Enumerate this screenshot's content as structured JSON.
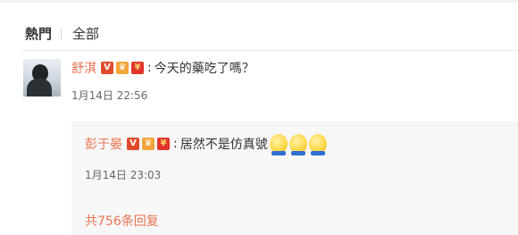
{
  "tabs": {
    "hot": "熱門",
    "all": "全部"
  },
  "comment": {
    "username": "舒淇",
    "separator": ":",
    "text": "今天的藥吃了嗎？",
    "time": "1月14日 22:56",
    "badges": [
      "v-badge-icon",
      "crown-badge-icon",
      "red-envelope-icon"
    ]
  },
  "reply": {
    "username": "彭于晏",
    "separator": ":",
    "text": "居然不是仿真號",
    "time": "1月14日 23:03",
    "emojis": [
      "emoji-icon",
      "emoji-icon",
      "emoji-icon"
    ]
  },
  "more_replies": "共756条回复",
  "colors": {
    "name": "#eb7350",
    "link": "#eb7350",
    "reply_bg": "#f7f7f7"
  }
}
